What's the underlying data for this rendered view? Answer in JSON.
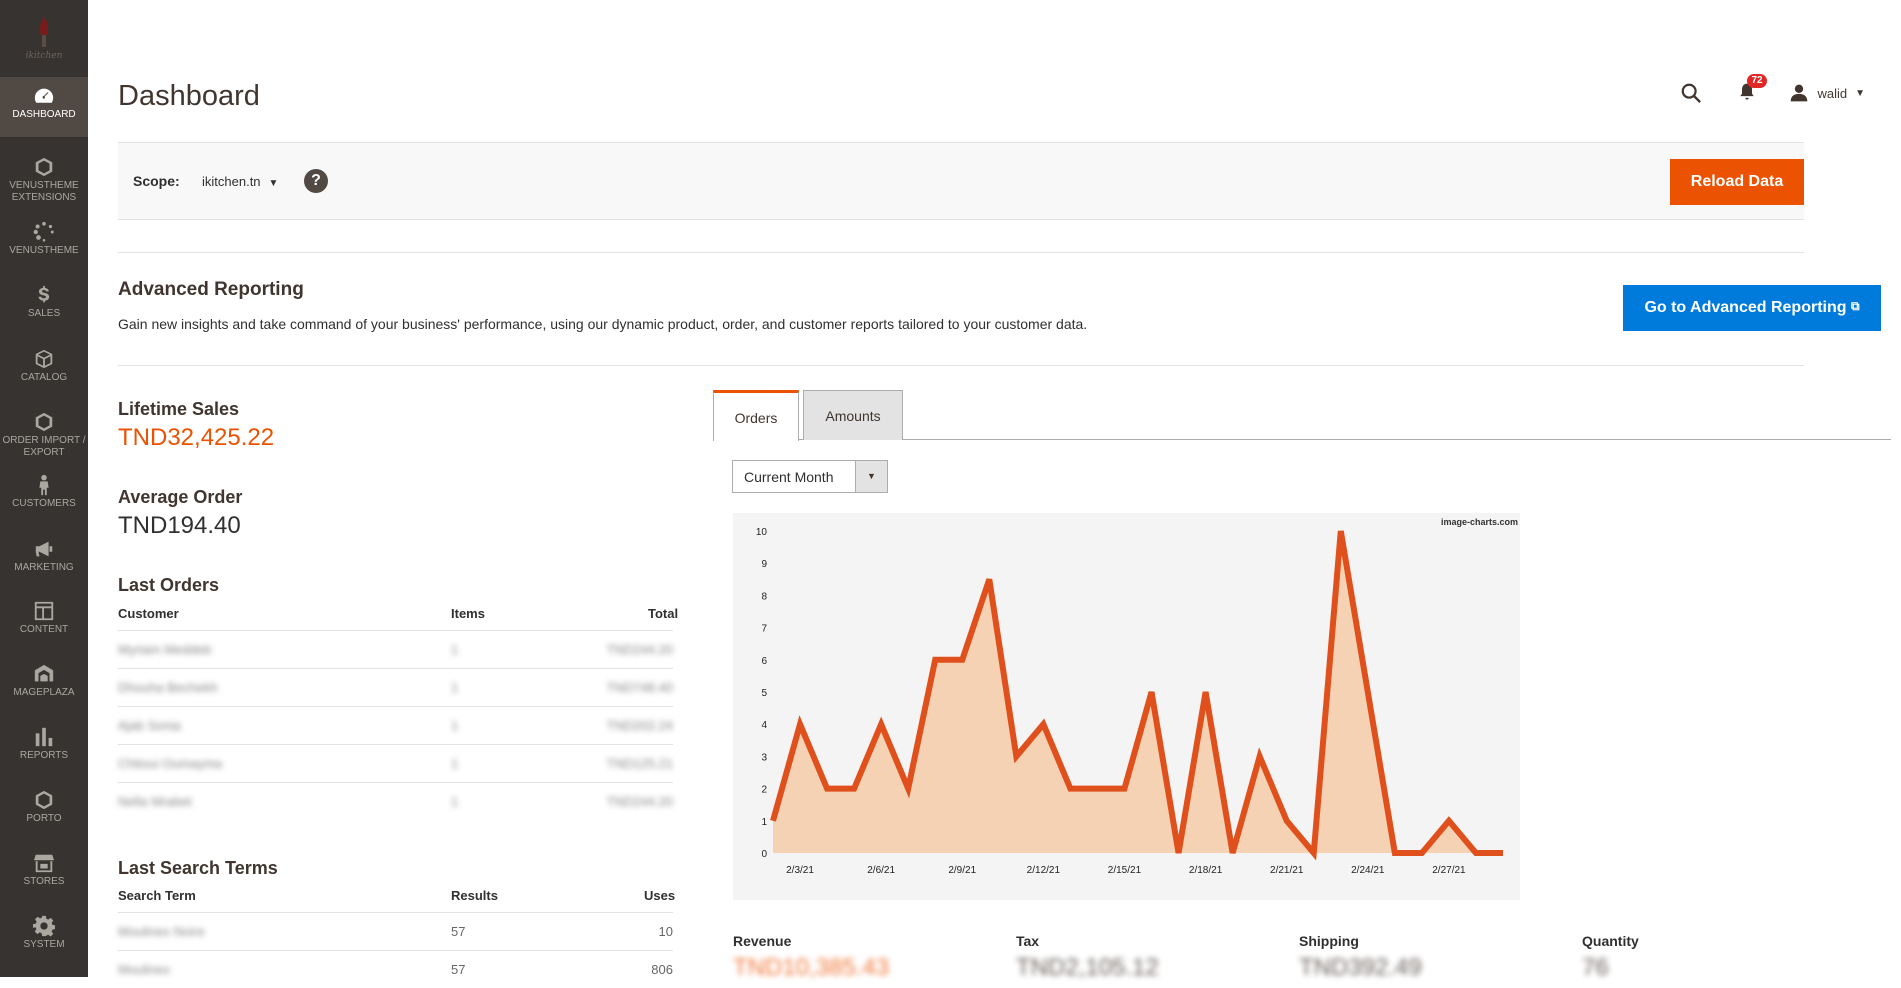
{
  "brand": {
    "logo_text": "ikitchen"
  },
  "sidebar": {
    "items": [
      {
        "label": "DASHBOARD",
        "icon": "dashboard-icon"
      },
      {
        "label": "VENUSTHEME EXTENSIONS",
        "icon": "hexagon-icon"
      },
      {
        "label": "VENUSTHEME",
        "icon": "spinner-icon"
      },
      {
        "label": "SALES",
        "icon": "dollar-icon"
      },
      {
        "label": "CATALOG",
        "icon": "box-icon"
      },
      {
        "label": "ORDER IMPORT / EXPORT",
        "icon": "hexagon-icon"
      },
      {
        "label": "CUSTOMERS",
        "icon": "person-icon"
      },
      {
        "label": "MARKETING",
        "icon": "megaphone-icon"
      },
      {
        "label": "CONTENT",
        "icon": "layout-icon"
      },
      {
        "label": "MAGEPLAZA",
        "icon": "mageplaza-icon"
      },
      {
        "label": "REPORTS",
        "icon": "bar-chart-icon"
      },
      {
        "label": "PORTO",
        "icon": "hexagon-icon"
      },
      {
        "label": "STORES",
        "icon": "store-icon"
      },
      {
        "label": "SYSTEM",
        "icon": "gear-icon"
      }
    ]
  },
  "header": {
    "title": "Dashboard",
    "notifications_count": "72",
    "user_name": "walid"
  },
  "scope": {
    "label": "Scope:",
    "value": "ikitchen.tn",
    "help": "?",
    "reload_label": "Reload Data"
  },
  "advanced": {
    "title": "Advanced Reporting",
    "description": "Gain new insights and take command of your business' performance, using our dynamic product, order, and customer reports tailored to your customer data.",
    "button_label": "Go to Advanced Reporting"
  },
  "stats": {
    "lifetime_sales_title": "Lifetime Sales",
    "lifetime_sales_value": "TND32,425.22",
    "average_order_title": "Average Order",
    "average_order_value": "TND194.40"
  },
  "last_orders": {
    "title": "Last Orders",
    "columns": [
      "Customer",
      "Items",
      "Total"
    ],
    "rows": [
      {
        "customer": "Myriam Meddeb",
        "items": "1",
        "total": "TND244.20"
      },
      {
        "customer": "Dhouha Bechekh",
        "items": "1",
        "total": "TND748.40"
      },
      {
        "customer": "Ajab Sonia",
        "items": "1",
        "total": "TND202.24"
      },
      {
        "customer": "Chtioui Oumayma",
        "items": "1",
        "total": "TND125.21"
      },
      {
        "customer": "Nella Mrabet",
        "items": "1",
        "total": "TND244.20"
      }
    ]
  },
  "last_search": {
    "title": "Last Search Terms",
    "columns": [
      "Search Term",
      "Results",
      "Uses"
    ],
    "rows": [
      {
        "term": "Moulinex Noire",
        "results": "57",
        "uses": "10"
      },
      {
        "term": "Moulinex",
        "results": "57",
        "uses": "806"
      }
    ]
  },
  "tabs": {
    "orders": "Orders",
    "amounts": "Amounts"
  },
  "period_select": {
    "value": "Current Month"
  },
  "chart_data": {
    "type": "area",
    "watermark": "image-charts.com",
    "x_ticks": [
      "2/3/21",
      "2/6/21",
      "2/9/21",
      "2/12/21",
      "2/15/21",
      "2/18/21",
      "2/21/21",
      "2/24/21",
      "2/27/21"
    ],
    "y_ticks": [
      "0",
      "1",
      "2",
      "3",
      "4",
      "5",
      "6",
      "7",
      "8",
      "9",
      "10"
    ],
    "ylim": [
      0,
      10
    ],
    "values": [
      1,
      4,
      2,
      2,
      4,
      2,
      6,
      6,
      8.5,
      3,
      4,
      2,
      2,
      2,
      5,
      0,
      5,
      0,
      3,
      1,
      0,
      10,
      5,
      0,
      0,
      1,
      0,
      0
    ],
    "line_color": "#e0501c",
    "fill_color": "#f6d2b4",
    "background": "#f4f4f4"
  },
  "totals": {
    "revenue_label": "Revenue",
    "revenue_value": "TND10,385.43",
    "tax_label": "Tax",
    "tax_value": "TND2,105.12",
    "shipping_label": "Shipping",
    "shipping_value": "TND392.49",
    "quantity_label": "Quantity",
    "quantity_value": "76"
  }
}
